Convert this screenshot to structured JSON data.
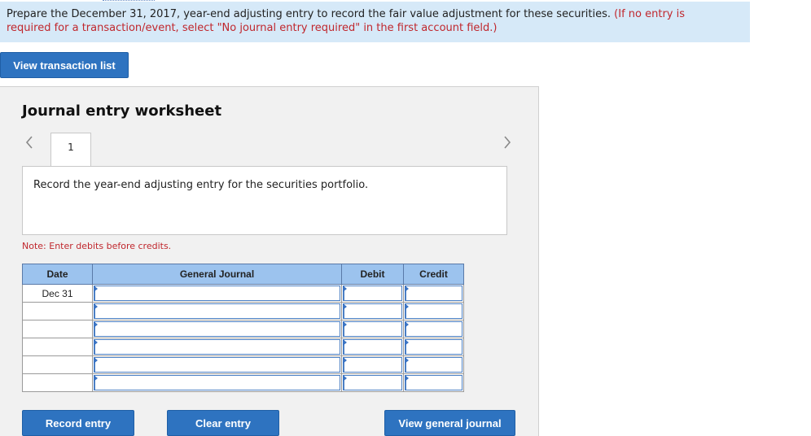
{
  "banner": {
    "instruction": "Prepare the December 31, 2017, year-end adjusting entry to record the fair value adjustment for these securities.",
    "hint": "(If no entry is required for a transaction/event, select \"No journal entry required\" in the first account field.)"
  },
  "buttons": {
    "view_transaction_list": "View transaction list",
    "record_entry": "Record entry",
    "clear_entry": "Clear entry",
    "view_general_journal": "View general journal"
  },
  "worksheet": {
    "title": "Journal entry worksheet",
    "tab_number": "1",
    "prev_icon": "chevron-left-icon",
    "next_icon": "chevron-right-icon",
    "description": "Record the year-end adjusting entry for the securities portfolio.",
    "note": "Note: Enter debits before credits."
  },
  "table": {
    "headers": [
      "Date",
      "General Journal",
      "Debit",
      "Credit"
    ],
    "rows": [
      {
        "date": "Dec 31",
        "account": "",
        "debit": "",
        "credit": ""
      },
      {
        "date": "",
        "account": "",
        "debit": "",
        "credit": ""
      },
      {
        "date": "",
        "account": "",
        "debit": "",
        "credit": ""
      },
      {
        "date": "",
        "account": "",
        "debit": "",
        "credit": ""
      },
      {
        "date": "",
        "account": "",
        "debit": "",
        "credit": ""
      },
      {
        "date": "",
        "account": "",
        "debit": "",
        "credit": ""
      }
    ]
  },
  "colors": {
    "banner_bg": "#d6e9f8",
    "accent": "#2e73c0",
    "header_bg": "#9cc3ee",
    "hint_red": "#c0272d"
  }
}
